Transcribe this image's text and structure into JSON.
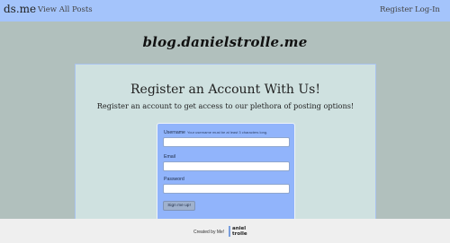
{
  "navbar": {
    "brand": "ds.me",
    "links": {
      "view_all_posts": "View All Posts",
      "register": "Register",
      "login": "Log-In"
    }
  },
  "site_title": "blog.danielstrolle.me",
  "panel": {
    "heading": "Register an Account With Us!",
    "subheading": "Register an account to get access to our plethora of posting options!"
  },
  "form": {
    "username_label": "Username",
    "username_hint": "Your username must be at least 3 characters long.",
    "username_value": "",
    "email_label": "Email",
    "email_value": "",
    "password_label": "Password",
    "password_value": "",
    "submit_label": "Sign me up!"
  },
  "footer": {
    "created_by": "Created by Me!",
    "logo_line1": "aniel",
    "logo_line2": "trolle"
  },
  "colors": {
    "navbar_bg": "#a4c4fb",
    "page_bg": "#b1c0bd",
    "panel_bg": "#cfe1e0",
    "form_bg": "#91b4fb",
    "footer_bg": "#efefef"
  }
}
